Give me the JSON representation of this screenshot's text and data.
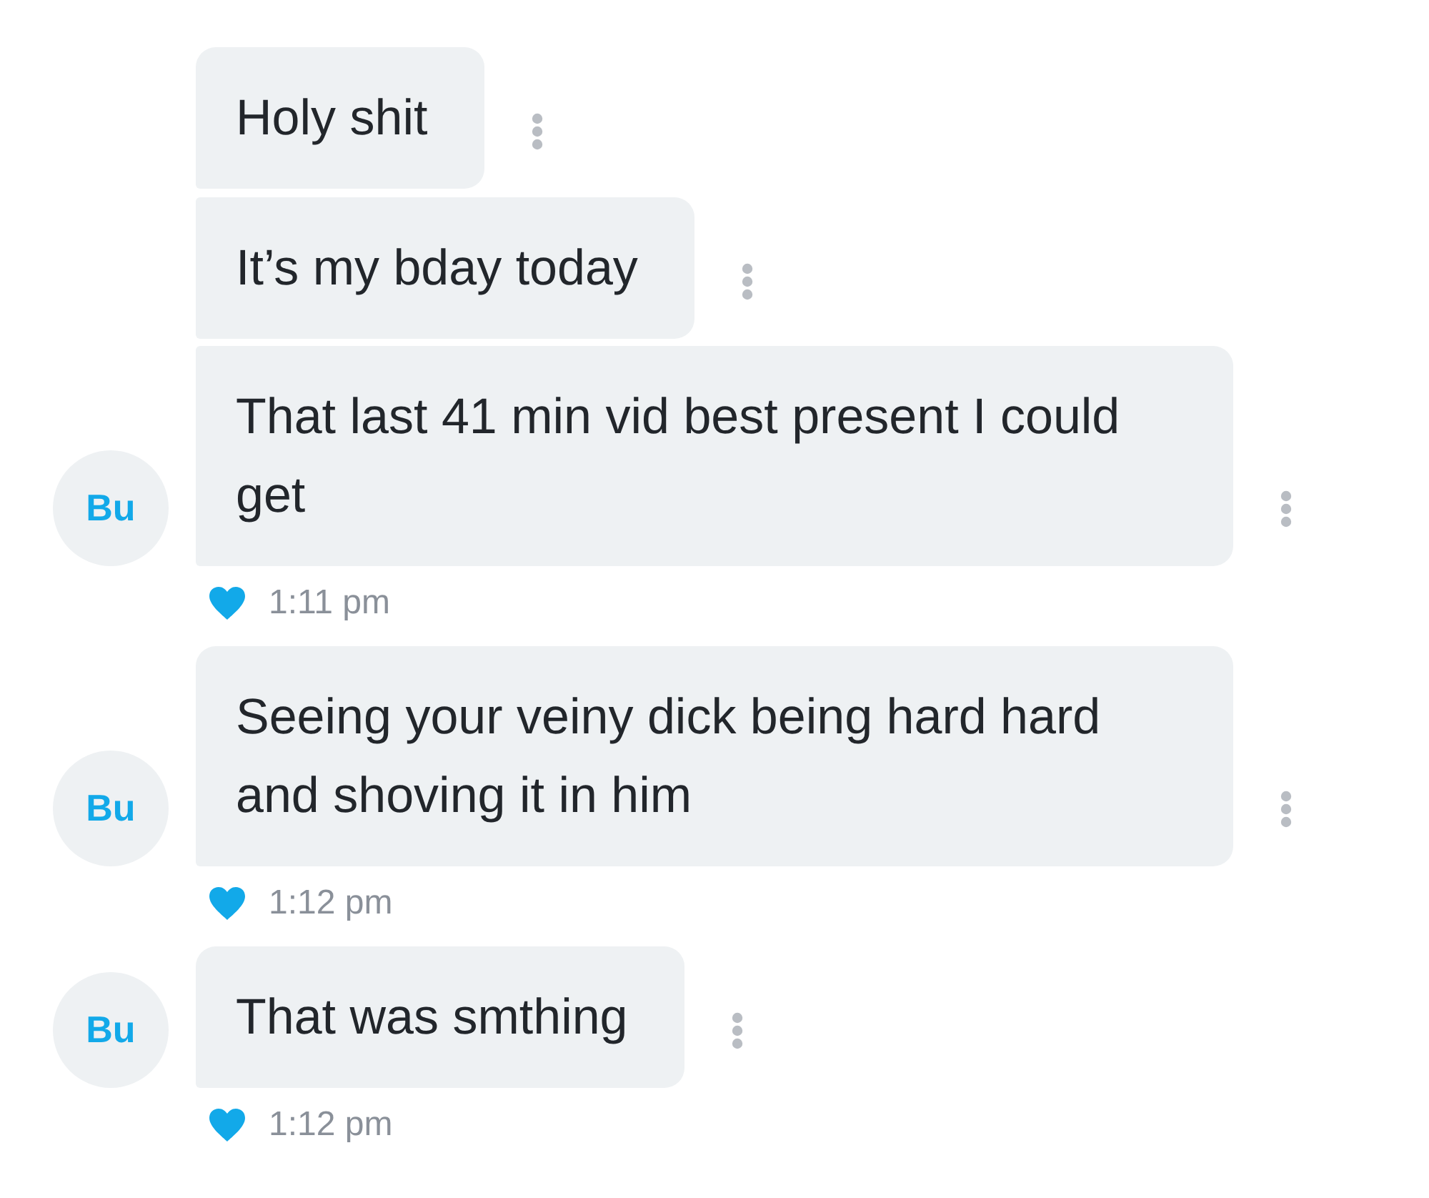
{
  "messages": [
    {
      "text": "Holy shit",
      "liked": false
    },
    {
      "text": "It’s my bday today",
      "liked": false
    },
    {
      "text": "That last 41 min vid best present I could get",
      "avatar": "Bu",
      "liked": true,
      "time": "1:11 pm"
    },
    {
      "text": "Seeing your veiny dick being hard hard and shoving it in him",
      "avatar": "Bu",
      "liked": true,
      "time": "1:12 pm"
    },
    {
      "text": "That was smthing",
      "avatar": "Bu",
      "liked": true,
      "time": "1:12 pm"
    }
  ]
}
